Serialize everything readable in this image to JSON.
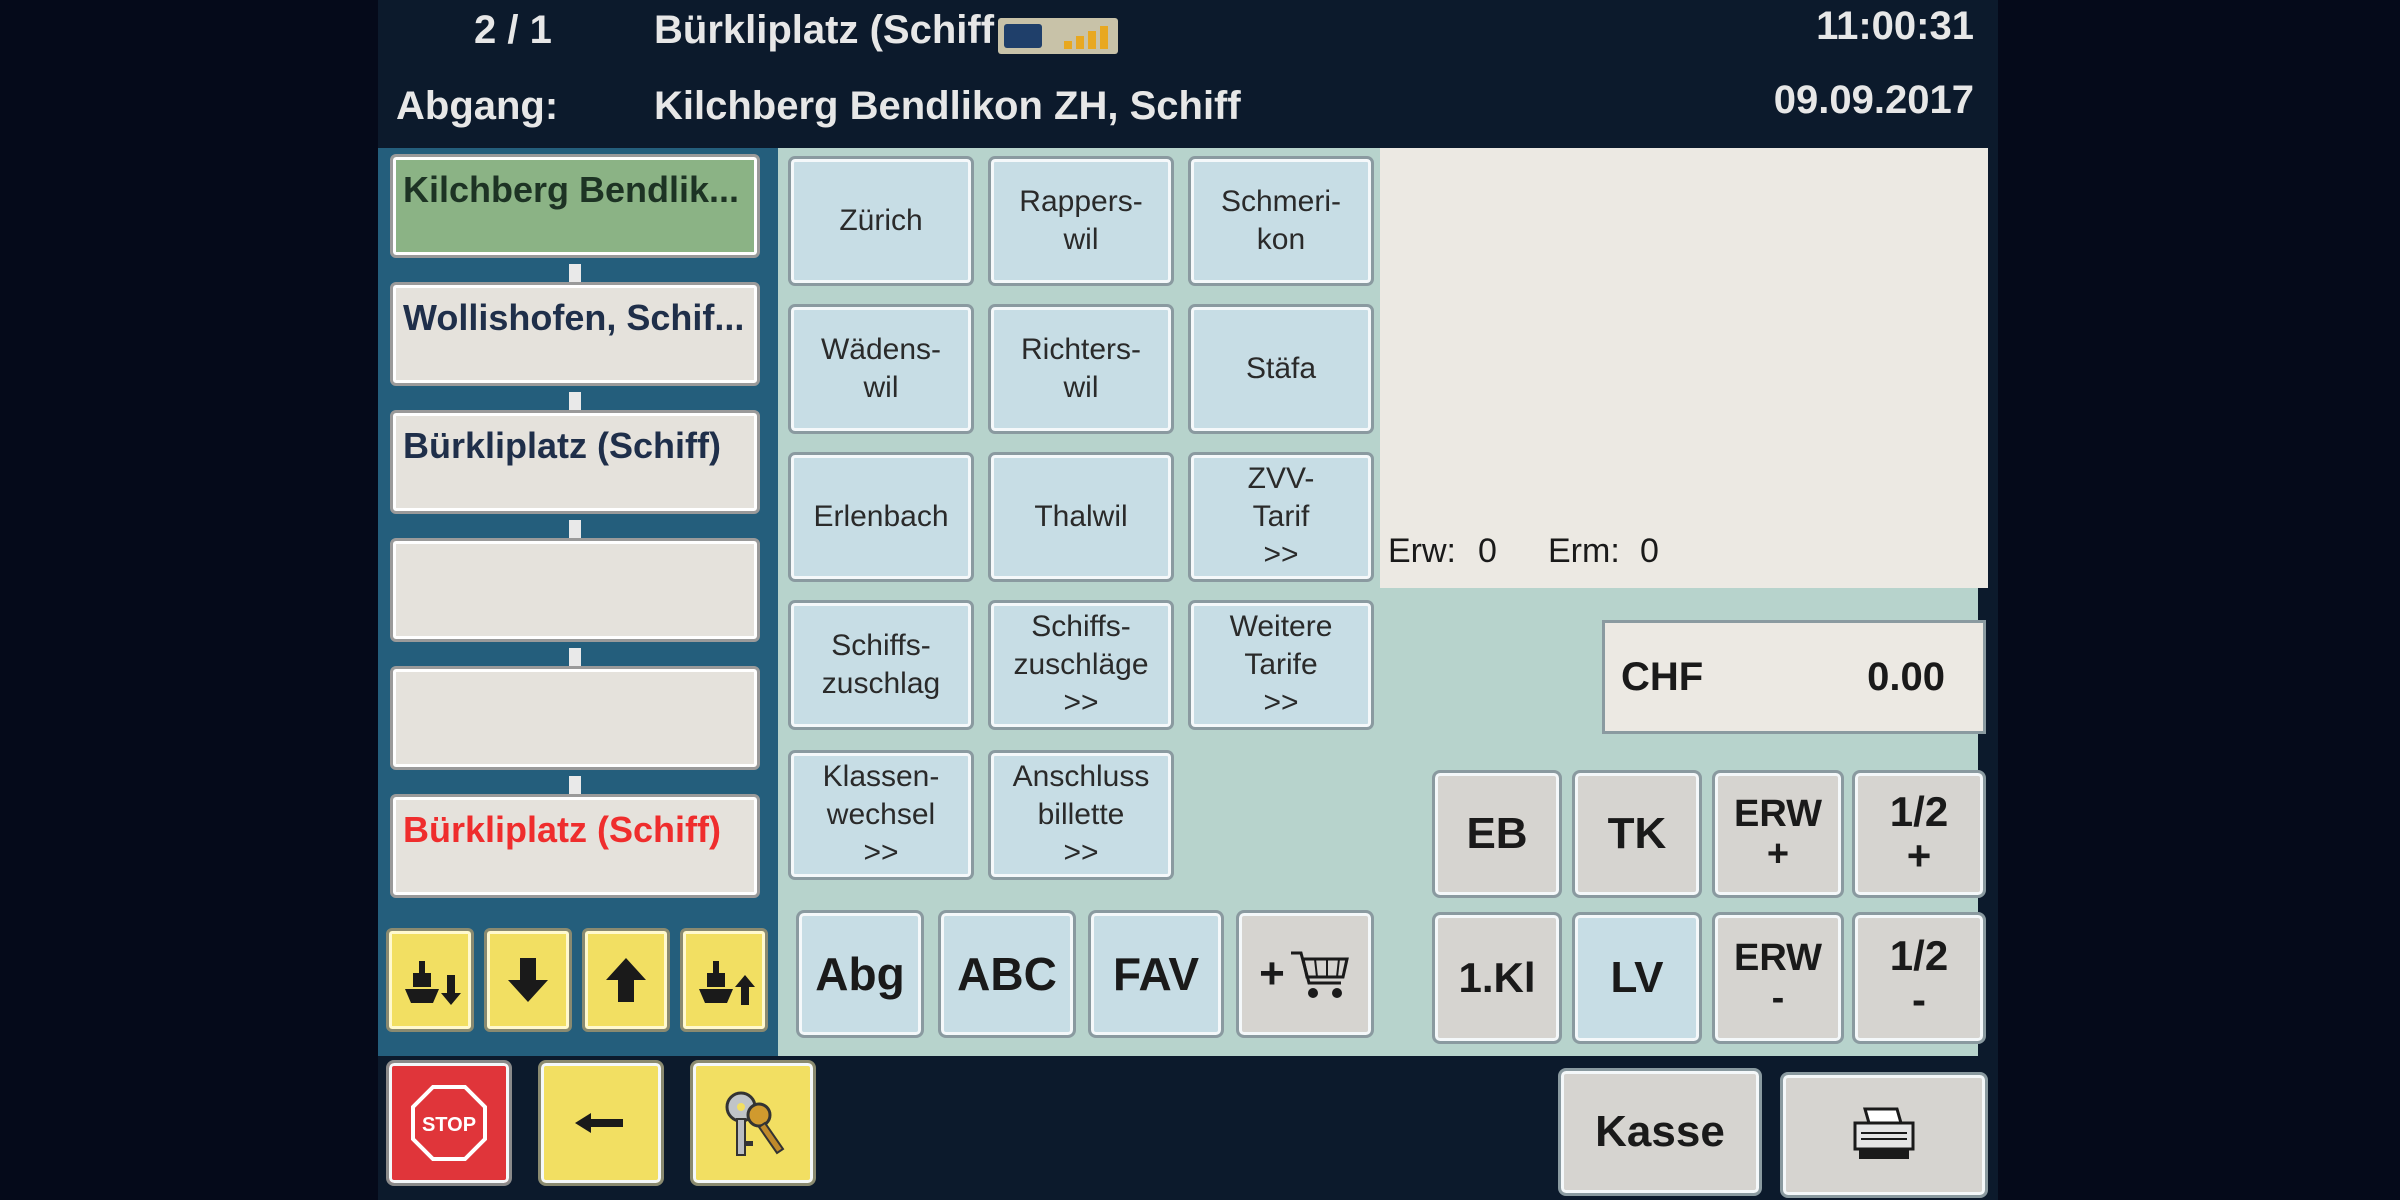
{
  "header": {
    "trip": "2 / 1",
    "destination": "Bürkliplatz (Schiff",
    "time": "11:00:31",
    "departure_label": "Abgang:",
    "departure_stop": "Kilchberg Bendlikon ZH, Schiff",
    "date": "09.09.2017"
  },
  "stops": [
    {
      "label": "Kilchberg Bendlik...",
      "state": "active"
    },
    {
      "label": "Wollishofen, Schif...",
      "state": "normal"
    },
    {
      "label": "Bürkliplatz (Schiff)",
      "state": "normal"
    },
    {
      "label": "",
      "state": "empty"
    },
    {
      "label": "",
      "state": "empty"
    },
    {
      "label": "Bürkliplatz (Schiff)",
      "state": "red"
    }
  ],
  "destinations": [
    "Zürich",
    "Rappers-\nwil",
    "Schmeri-\nkon",
    "Wädens-\nwil",
    "Richters-\nwil",
    "Stäfa",
    "Erlenbach",
    "Thalwil",
    "ZVV-\nTarif\n>>",
    "Schiffs-\nzuschlag",
    "Schiffs-\nzuschläge\n>>",
    "Weitere\nTarife\n>>",
    "Klassen-\nwechsel\n>>",
    "Anschluss\nbillette\n>>"
  ],
  "search_buttons": [
    "Abg",
    "ABC",
    "FAV",
    "+"
  ],
  "counters": {
    "erw_label": "Erw:",
    "erw_value": "0",
    "erm_label": "Erm:",
    "erm_value": "0"
  },
  "total": {
    "currency": "CHF",
    "amount": "0.00"
  },
  "ticket_buttons": [
    {
      "label": "EB",
      "color": "gray"
    },
    {
      "label": "TK",
      "color": "gray"
    },
    {
      "label": "ERW\n+",
      "color": "gray"
    },
    {
      "label": "1/2\n+",
      "color": "gray"
    },
    {
      "label": "1.Kl",
      "color": "gray"
    },
    {
      "label": "LV",
      "color": "blue"
    },
    {
      "label": "ERW\n-",
      "color": "gray"
    },
    {
      "label": "1/2\n-",
      "color": "gray"
    }
  ],
  "bottom": {
    "stop_label": "STOP",
    "kasse_label": "Kasse"
  },
  "icons": [
    "ship-down-icon",
    "arrow-down-icon",
    "arrow-up-icon",
    "ship-up-icon",
    "stop-sign-icon",
    "back-arrow-icon",
    "keys-icon",
    "cart-icon",
    "printer-icon",
    "signal-icon"
  ],
  "colors": {
    "active_stop": "#8bb385",
    "red_stop_text": "#ef2d2d",
    "nav_yellow": "#f2df62",
    "stop_red": "#e0353a",
    "panel": "#b7d3cc"
  }
}
